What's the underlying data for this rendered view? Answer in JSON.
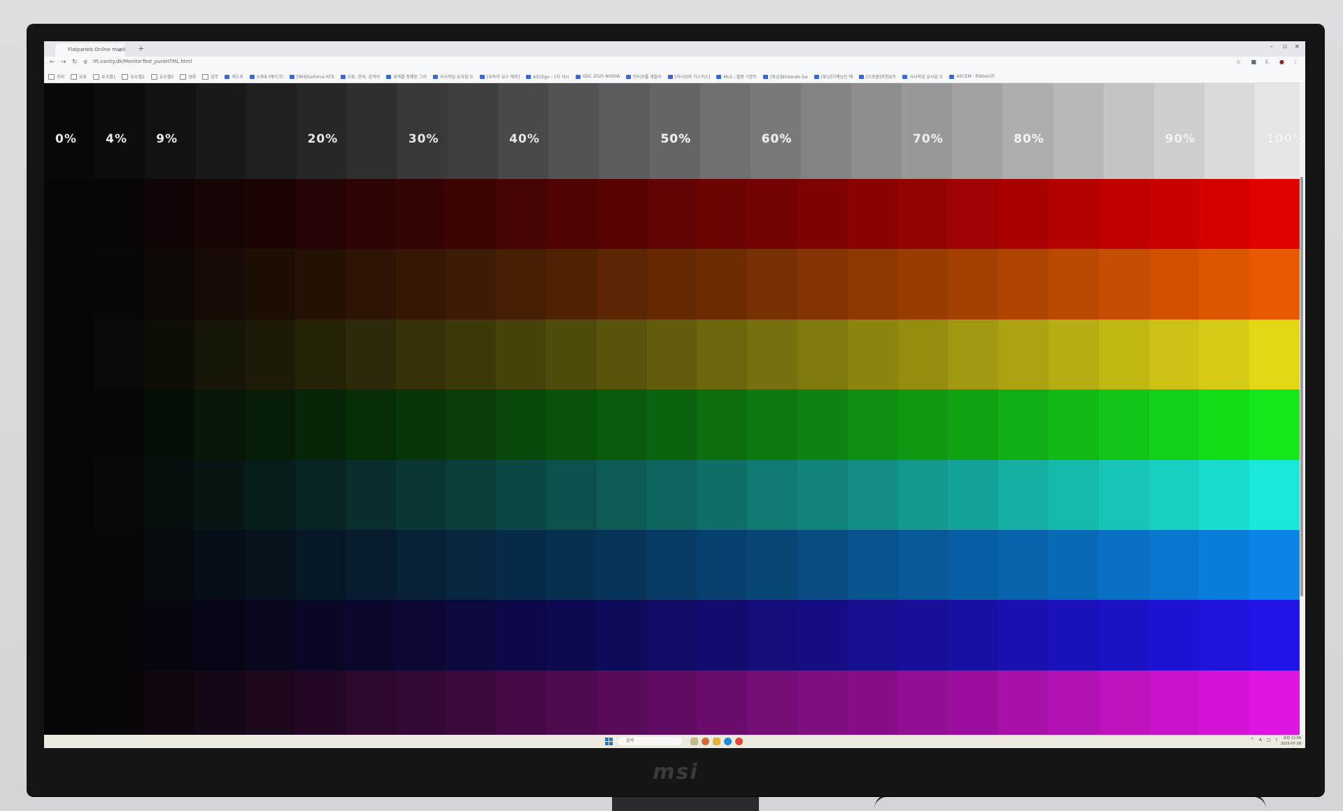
{
  "browser": {
    "tab_title": "Flatpanels Online monitor t",
    "tab_close": "×",
    "tab_add": "+",
    "url": "tft.vanity.dk/MonitorTest_pureHTML.html",
    "window_controls": [
      "–",
      "▫",
      "×"
    ],
    "bookmarks": [
      "관리",
      "유튜",
      "유소챌1",
      "유소챌2",
      "유소챌3",
      "영화",
      "업무",
      "레드포",
      "5세대 (메이크)",
      "[재테]GeForce RTX",
      "모튜, 한국, 검색어",
      "세계를 정체된 그리",
      "사시작업 유사업 도",
      "[유독이 유스 해외]",
      "ASCEgo - 1차 게시",
      "GDC 2025 NVIDIA",
      "인터모롤 개발자",
      "[가시상마 가스카스]",
      "MLS - 월중 기본트",
      "[튜닝]Nintendo Sw",
      "[튜닝]기계능인 메",
      "[스포봄]추천유트",
      "사사작업 유사업 도",
      "ASCEM - Ribbon(f)"
    ]
  },
  "test_pattern": {
    "percent_labels": [
      "0%",
      "4%",
      "9%",
      "20%",
      "30%",
      "40%",
      "50%",
      "60%",
      "70%",
      "80%",
      "90%",
      "100%"
    ],
    "steps": 25,
    "row_colors": [
      {
        "name": "red",
        "hex": "#e10000"
      },
      {
        "name": "orange",
        "hex": "#e85a00"
      },
      {
        "name": "yellow",
        "hex": "#e3d716"
      },
      {
        "name": "green",
        "hex": "#14e81a"
      },
      {
        "name": "cyan",
        "hex": "#1ae8d8"
      },
      {
        "name": "blue",
        "hex": "#0a84e6"
      },
      {
        "name": "indigo",
        "hex": "#2014e8"
      },
      {
        "name": "magenta",
        "hex": "#de14e0"
      }
    ],
    "bottom_peek_color": "#e0126a"
  },
  "taskbar": {
    "search_placeholder": "검색",
    "tray": [
      "^",
      "A",
      "□",
      ")"
    ],
    "time": "오전 11:06",
    "date": "2025-07-28"
  },
  "monitor": {
    "brand": "msi"
  }
}
